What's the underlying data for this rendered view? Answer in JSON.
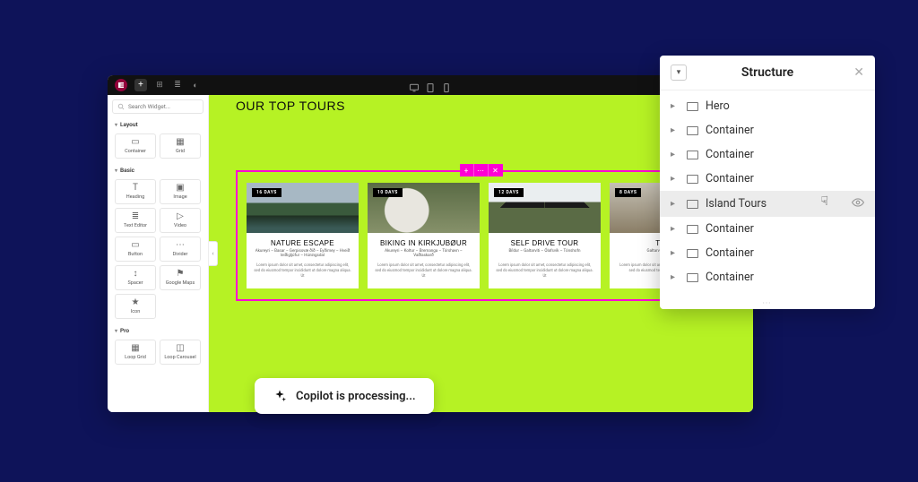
{
  "editor": {
    "search_placeholder": "Search Widget...",
    "topbar": {
      "devices": [
        "desktop",
        "tablet",
        "mobile"
      ]
    }
  },
  "widget_panel": {
    "sections": [
      {
        "label": "Layout",
        "tiles": [
          {
            "name": "container",
            "label": "Container",
            "icon": "▭"
          },
          {
            "name": "grid",
            "label": "Grid",
            "icon": "▦"
          }
        ]
      },
      {
        "label": "Basic",
        "tiles": [
          {
            "name": "heading",
            "label": "Heading",
            "icon": "T"
          },
          {
            "name": "image",
            "label": "Image",
            "icon": "▣"
          },
          {
            "name": "text-editor",
            "label": "Text Editor",
            "icon": "≣"
          },
          {
            "name": "video",
            "label": "Video",
            "icon": "▷"
          },
          {
            "name": "button",
            "label": "Button",
            "icon": "▭"
          },
          {
            "name": "divider",
            "label": "Divider",
            "icon": "⋯"
          },
          {
            "name": "spacer",
            "label": "Spacer",
            "icon": "↕"
          },
          {
            "name": "google-maps",
            "label": "Google Maps",
            "icon": "⚑"
          },
          {
            "name": "icon",
            "label": "Icon",
            "icon": "★"
          }
        ]
      },
      {
        "label": "Pro",
        "tiles": [
          {
            "name": "loop-grid",
            "label": "Loop Grid",
            "icon": "▦"
          },
          {
            "name": "loop-carousel",
            "label": "Loop Carousel",
            "icon": "◫"
          }
        ]
      }
    ]
  },
  "canvas": {
    "hero_title": "OUR TOP TOURS",
    "section_actions": {
      "add": "+",
      "edit": "⋯",
      "close": "✕"
    },
    "cards": [
      {
        "badge": "16 DAYS",
        "title": "NATURE ESCAPE",
        "sub": "Akureyri – Basar – Gerpissvæ ðið – Eyðimey – Hveið leiðigljúfur – Húningsdal",
        "desc": "Lorem ipsum dolor sit amet, consectetur adipiscing elit, sed do eiusmod tempor incididunt ut dolore magna aliqua. Ut"
      },
      {
        "badge": "10 DAYS",
        "title": "BIKING IN KIRKJUBØUR",
        "sub": "Akureyri – Koltur – Bremanga – Tórshavn – Vaðlaskarð",
        "desc": "Lorem ipsum dolor sit amet, consectetur adipiscing elit, sed do eiusmod tempor incididunt ut dolore magna aliqua. Ut"
      },
      {
        "badge": "12 DAYS",
        "title": "SELF DRIVE TOUR",
        "sub": "Bíldur – Galtarviti – Ólafsvík – Tónshofn",
        "desc": "Lorem ipsum dolor sit amet, consectetur adipiscing elit, sed do eiusmod tempor incididunt ut dolore magna aliqua. Ut"
      },
      {
        "badge": "8 DAYS",
        "title": "TREK",
        "sub": "Galtarviti – Tónshofn",
        "desc": "Lorem ipsum dolor sit amet, consectetur adipiscing elit, sed do eiusmod tempor incididunt ut dolore."
      }
    ]
  },
  "copilot": {
    "status": "Copilot is processing..."
  },
  "structure": {
    "title": "Structure",
    "items": [
      {
        "label": "Hero",
        "selected": false
      },
      {
        "label": "Container",
        "selected": false
      },
      {
        "label": "Container",
        "selected": false
      },
      {
        "label": "Container",
        "selected": false
      },
      {
        "label": "Island Tours",
        "selected": true
      },
      {
        "label": "Container",
        "selected": false
      },
      {
        "label": "Container",
        "selected": false
      },
      {
        "label": "Container",
        "selected": false
      }
    ]
  }
}
